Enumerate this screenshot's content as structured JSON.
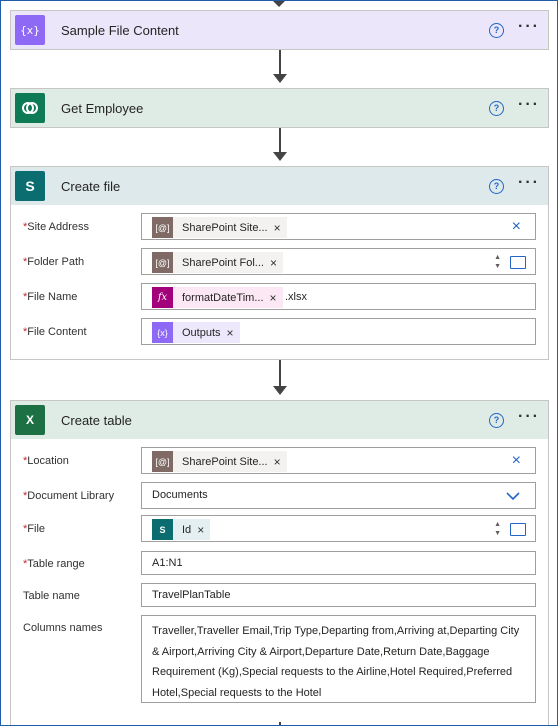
{
  "cards": {
    "sample": {
      "title": "Sample File Content"
    },
    "employee": {
      "title": "Get Employee"
    },
    "createfile": {
      "title": "Create file",
      "fields": {
        "site_label": "Site Address",
        "site_token": "SharePoint Site...",
        "folder_label": "Folder Path",
        "folder_token": "SharePoint Fol...",
        "name_label": "File Name",
        "name_token": "formatDateTim...",
        "name_suffix": ".xlsx",
        "content_label": "File Content",
        "content_token": "Outputs"
      }
    },
    "table": {
      "title": "Create table",
      "fields": {
        "location_label": "Location",
        "location_token": "SharePoint Site...",
        "library_label": "Document Library",
        "library_value": "Documents",
        "file_label": "File",
        "file_token": "Id",
        "range_label": "Table range",
        "range_value": "A1:N1",
        "tname_label": "Table name",
        "tname_value": "TravelPlanTable",
        "columns_label": "Columns names",
        "columns_value": "Traveller,Traveller Email,Trip Type,Departing from,Arriving at,Departing City & Airport,Arriving City & Airport,Departure Date,Return Date,Baggage Requirement (Kg),Special requests to the Airline,Hotel Required,Preferred Hotel,Special requests to the Hotel"
      }
    }
  },
  "common": {
    "help": "?",
    "more": "···",
    "close": "×",
    "required": "*"
  },
  "colors": {
    "sample_head": "#ece6fb",
    "employee_head": "#dfece6",
    "createfile_head": "#dde9ea",
    "table_head": "#dfece6",
    "dataverse": "#0f7a56",
    "sharepoint": "#0b6d70",
    "excel": "#1c7043",
    "variable": "#8e69f5",
    "expression": "#a3007c",
    "dynamic": "#7f6a65"
  }
}
